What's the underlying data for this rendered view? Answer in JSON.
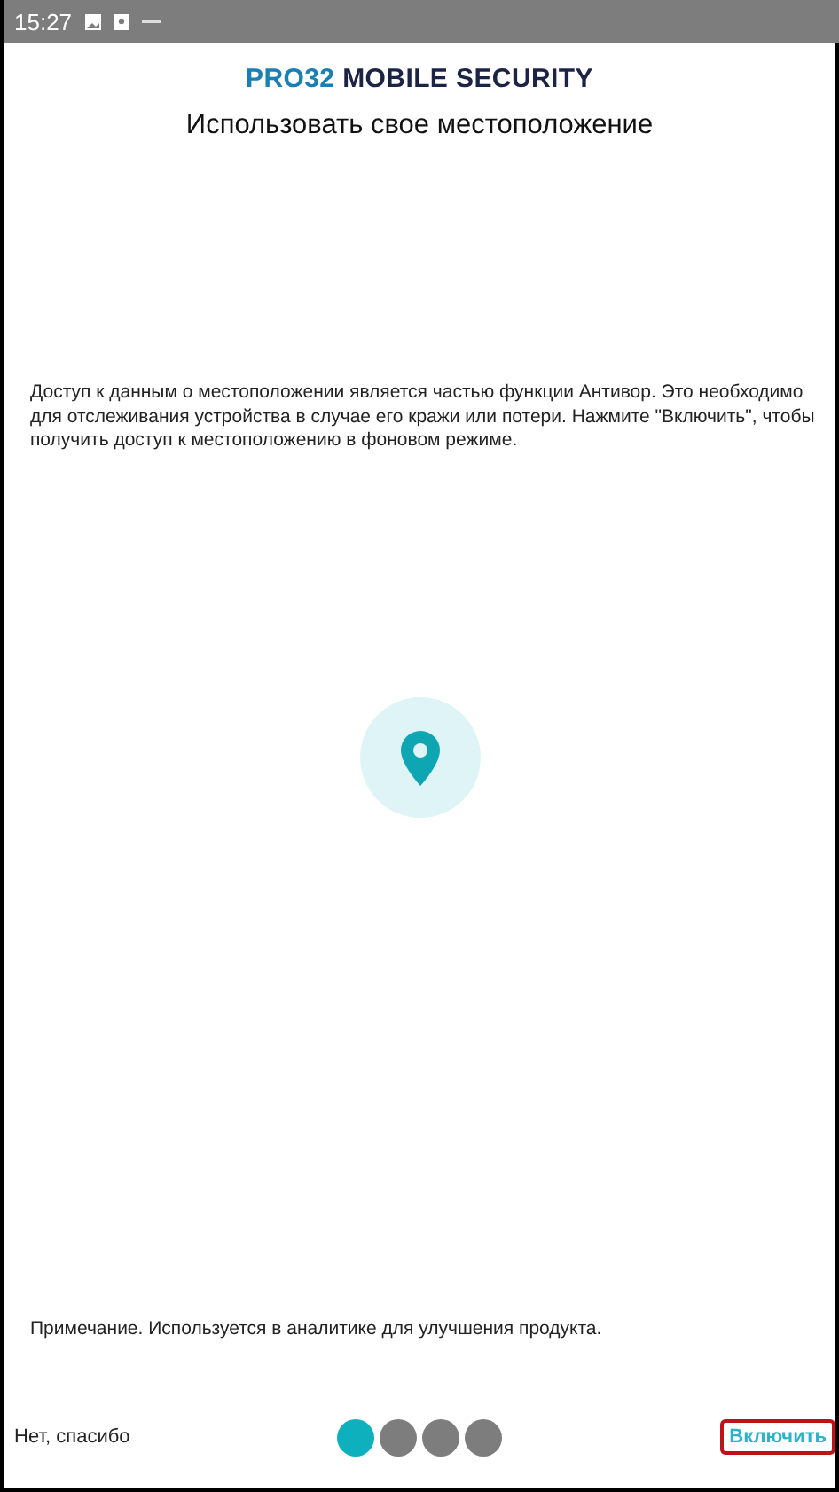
{
  "status_bar": {
    "time": "15:27"
  },
  "logo": {
    "brand": "PRO32",
    "product": "MOBILE SECURITY"
  },
  "title": "Использовать свое местоположение",
  "description": "Доступ к данным о местоположении является частью функции Антивор. Это необходимо для отслеживания устройства в случае его кражи или потери. Нажмите \"Включить\", чтобы получить доступ к местоположению в фоновом режиме.",
  "note": "Примечание. Используется в аналитике для улучшения продукта.",
  "footer": {
    "decline": "Нет, спасибо",
    "pages": [
      {
        "selected": true
      },
      {
        "selected": false
      },
      {
        "selected": false
      },
      {
        "selected": false
      }
    ],
    "accept": {
      "label": "Включить",
      "highlighted": true
    }
  }
}
